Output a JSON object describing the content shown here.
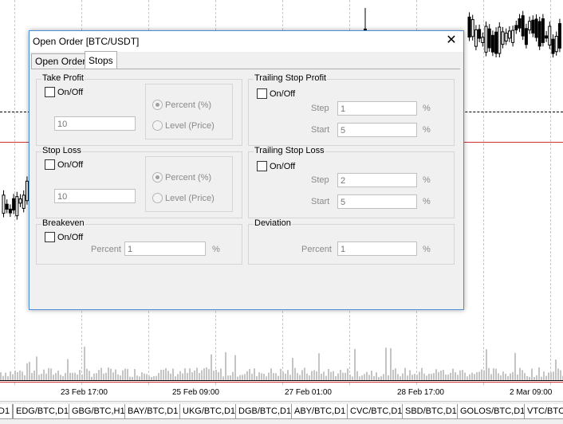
{
  "dialog": {
    "title": "Open Order [BTC/USDT]",
    "close_glyph": "✕",
    "tabs": [
      "Open Order",
      "Stops"
    ],
    "active_tab": "Stops"
  },
  "take_profit": {
    "title": "Take Profit",
    "onoff": "On/Off",
    "value": "10",
    "radio_percent": "Percent (%)",
    "radio_level": "Level (Price)"
  },
  "stop_loss": {
    "title": "Stop Loss",
    "onoff": "On/Off",
    "value": "10",
    "radio_percent": "Percent (%)",
    "radio_level": "Level (Price)"
  },
  "breakeven": {
    "title": "Breakeven",
    "onoff": "On/Off",
    "percent_label": "Percent",
    "percent_value": "1",
    "unit": "%"
  },
  "trailing_profit": {
    "title": "Trailing Stop Profit",
    "onoff": "On/Off",
    "step_label": "Step",
    "step_value": "1",
    "start_label": "Start",
    "start_value": "5",
    "unit": "%"
  },
  "trailing_loss": {
    "title": "Trailing Stop Loss",
    "onoff": "On/Off",
    "step_label": "Step",
    "step_value": "2",
    "start_label": "Start",
    "start_value": "5",
    "unit": "%"
  },
  "deviation": {
    "title": "Deviation",
    "percent_label": "Percent",
    "percent_value": "1",
    "unit": "%"
  },
  "chart": {
    "x_ticks": [
      "23 Feb 17:00",
      "25 Feb 09:00",
      "27 Feb 01:00",
      "28 Feb 17:00",
      "2 Mar 09:00"
    ],
    "symbol_tabs": [
      "D1",
      "EDG/BTC,D1",
      "GBG/BTC,H1",
      "BAY/BTC,D1",
      "UKG/BTC,D1",
      "DGB/BTC,D1",
      "ABY/BTC,D1",
      "CVC/BTC,D1",
      "SBD/BTC,D1",
      "GOLOS/BTC,D1",
      "VTC/BTC,"
    ]
  },
  "colors": {
    "dialog_border": "#4a90d9",
    "red_line": "#cc3333",
    "panel_bg": "#f0f0f0"
  }
}
